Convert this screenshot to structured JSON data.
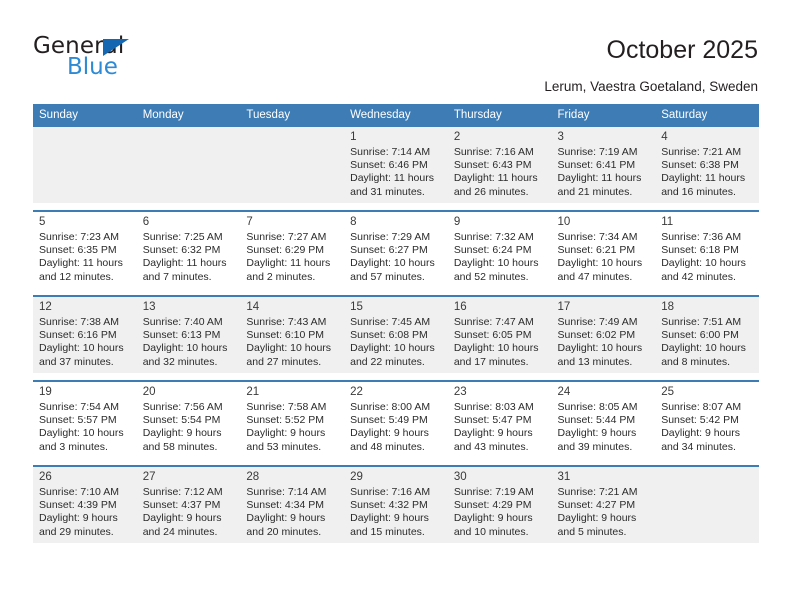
{
  "brand": {
    "name_part1": "General",
    "name_part2": "Blue",
    "accent_color": "#1567b2",
    "logo_blue": "#2e8ad4"
  },
  "header": {
    "title": "October 2025",
    "location": "Lerum, Vaestra Goetaland, Sweden"
  },
  "calendar": {
    "header_bg": "#3d7cb5",
    "shaded_row_bg": "#f0f0f0",
    "weekdays": [
      "Sunday",
      "Monday",
      "Tuesday",
      "Wednesday",
      "Thursday",
      "Friday",
      "Saturday"
    ],
    "labels": {
      "sunrise": "Sunrise:",
      "sunset": "Sunset:",
      "daylight": "Daylight:"
    },
    "weeks": [
      [
        null,
        null,
        null,
        {
          "day": "1",
          "sunrise": "Sunrise: 7:14 AM",
          "sunset": "Sunset: 6:46 PM",
          "daylight_1": "Daylight: 11 hours",
          "daylight_2": "and 31 minutes."
        },
        {
          "day": "2",
          "sunrise": "Sunrise: 7:16 AM",
          "sunset": "Sunset: 6:43 PM",
          "daylight_1": "Daylight: 11 hours",
          "daylight_2": "and 26 minutes."
        },
        {
          "day": "3",
          "sunrise": "Sunrise: 7:19 AM",
          "sunset": "Sunset: 6:41 PM",
          "daylight_1": "Daylight: 11 hours",
          "daylight_2": "and 21 minutes."
        },
        {
          "day": "4",
          "sunrise": "Sunrise: 7:21 AM",
          "sunset": "Sunset: 6:38 PM",
          "daylight_1": "Daylight: 11 hours",
          "daylight_2": "and 16 minutes."
        }
      ],
      [
        {
          "day": "5",
          "sunrise": "Sunrise: 7:23 AM",
          "sunset": "Sunset: 6:35 PM",
          "daylight_1": "Daylight: 11 hours",
          "daylight_2": "and 12 minutes."
        },
        {
          "day": "6",
          "sunrise": "Sunrise: 7:25 AM",
          "sunset": "Sunset: 6:32 PM",
          "daylight_1": "Daylight: 11 hours",
          "daylight_2": "and 7 minutes."
        },
        {
          "day": "7",
          "sunrise": "Sunrise: 7:27 AM",
          "sunset": "Sunset: 6:29 PM",
          "daylight_1": "Daylight: 11 hours",
          "daylight_2": "and 2 minutes."
        },
        {
          "day": "8",
          "sunrise": "Sunrise: 7:29 AM",
          "sunset": "Sunset: 6:27 PM",
          "daylight_1": "Daylight: 10 hours",
          "daylight_2": "and 57 minutes."
        },
        {
          "day": "9",
          "sunrise": "Sunrise: 7:32 AM",
          "sunset": "Sunset: 6:24 PM",
          "daylight_1": "Daylight: 10 hours",
          "daylight_2": "and 52 minutes."
        },
        {
          "day": "10",
          "sunrise": "Sunrise: 7:34 AM",
          "sunset": "Sunset: 6:21 PM",
          "daylight_1": "Daylight: 10 hours",
          "daylight_2": "and 47 minutes."
        },
        {
          "day": "11",
          "sunrise": "Sunrise: 7:36 AM",
          "sunset": "Sunset: 6:18 PM",
          "daylight_1": "Daylight: 10 hours",
          "daylight_2": "and 42 minutes."
        }
      ],
      [
        {
          "day": "12",
          "sunrise": "Sunrise: 7:38 AM",
          "sunset": "Sunset: 6:16 PM",
          "daylight_1": "Daylight: 10 hours",
          "daylight_2": "and 37 minutes."
        },
        {
          "day": "13",
          "sunrise": "Sunrise: 7:40 AM",
          "sunset": "Sunset: 6:13 PM",
          "daylight_1": "Daylight: 10 hours",
          "daylight_2": "and 32 minutes."
        },
        {
          "day": "14",
          "sunrise": "Sunrise: 7:43 AM",
          "sunset": "Sunset: 6:10 PM",
          "daylight_1": "Daylight: 10 hours",
          "daylight_2": "and 27 minutes."
        },
        {
          "day": "15",
          "sunrise": "Sunrise: 7:45 AM",
          "sunset": "Sunset: 6:08 PM",
          "daylight_1": "Daylight: 10 hours",
          "daylight_2": "and 22 minutes."
        },
        {
          "day": "16",
          "sunrise": "Sunrise: 7:47 AM",
          "sunset": "Sunset: 6:05 PM",
          "daylight_1": "Daylight: 10 hours",
          "daylight_2": "and 17 minutes."
        },
        {
          "day": "17",
          "sunrise": "Sunrise: 7:49 AM",
          "sunset": "Sunset: 6:02 PM",
          "daylight_1": "Daylight: 10 hours",
          "daylight_2": "and 13 minutes."
        },
        {
          "day": "18",
          "sunrise": "Sunrise: 7:51 AM",
          "sunset": "Sunset: 6:00 PM",
          "daylight_1": "Daylight: 10 hours",
          "daylight_2": "and 8 minutes."
        }
      ],
      [
        {
          "day": "19",
          "sunrise": "Sunrise: 7:54 AM",
          "sunset": "Sunset: 5:57 PM",
          "daylight_1": "Daylight: 10 hours",
          "daylight_2": "and 3 minutes."
        },
        {
          "day": "20",
          "sunrise": "Sunrise: 7:56 AM",
          "sunset": "Sunset: 5:54 PM",
          "daylight_1": "Daylight: 9 hours",
          "daylight_2": "and 58 minutes."
        },
        {
          "day": "21",
          "sunrise": "Sunrise: 7:58 AM",
          "sunset": "Sunset: 5:52 PM",
          "daylight_1": "Daylight: 9 hours",
          "daylight_2": "and 53 minutes."
        },
        {
          "day": "22",
          "sunrise": "Sunrise: 8:00 AM",
          "sunset": "Sunset: 5:49 PM",
          "daylight_1": "Daylight: 9 hours",
          "daylight_2": "and 48 minutes."
        },
        {
          "day": "23",
          "sunrise": "Sunrise: 8:03 AM",
          "sunset": "Sunset: 5:47 PM",
          "daylight_1": "Daylight: 9 hours",
          "daylight_2": "and 43 minutes."
        },
        {
          "day": "24",
          "sunrise": "Sunrise: 8:05 AM",
          "sunset": "Sunset: 5:44 PM",
          "daylight_1": "Daylight: 9 hours",
          "daylight_2": "and 39 minutes."
        },
        {
          "day": "25",
          "sunrise": "Sunrise: 8:07 AM",
          "sunset": "Sunset: 5:42 PM",
          "daylight_1": "Daylight: 9 hours",
          "daylight_2": "and 34 minutes."
        }
      ],
      [
        {
          "day": "26",
          "sunrise": "Sunrise: 7:10 AM",
          "sunset": "Sunset: 4:39 PM",
          "daylight_1": "Daylight: 9 hours",
          "daylight_2": "and 29 minutes."
        },
        {
          "day": "27",
          "sunrise": "Sunrise: 7:12 AM",
          "sunset": "Sunset: 4:37 PM",
          "daylight_1": "Daylight: 9 hours",
          "daylight_2": "and 24 minutes."
        },
        {
          "day": "28",
          "sunrise": "Sunrise: 7:14 AM",
          "sunset": "Sunset: 4:34 PM",
          "daylight_1": "Daylight: 9 hours",
          "daylight_2": "and 20 minutes."
        },
        {
          "day": "29",
          "sunrise": "Sunrise: 7:16 AM",
          "sunset": "Sunset: 4:32 PM",
          "daylight_1": "Daylight: 9 hours",
          "daylight_2": "and 15 minutes."
        },
        {
          "day": "30",
          "sunrise": "Sunrise: 7:19 AM",
          "sunset": "Sunset: 4:29 PM",
          "daylight_1": "Daylight: 9 hours",
          "daylight_2": "and 10 minutes."
        },
        {
          "day": "31",
          "sunrise": "Sunrise: 7:21 AM",
          "sunset": "Sunset: 4:27 PM",
          "daylight_1": "Daylight: 9 hours",
          "daylight_2": "and 5 minutes."
        },
        null
      ]
    ]
  }
}
